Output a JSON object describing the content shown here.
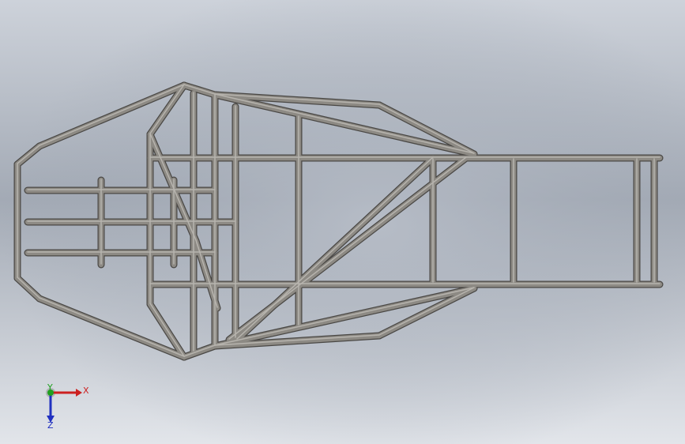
{
  "viewport": {
    "background_top": "#c9ced6",
    "background_mid": "#a4abb6",
    "background_bottom": "#dfe2e7",
    "model": "tube-frame-chassis",
    "view": "top"
  },
  "triad": {
    "x_label": "X",
    "y_label": "Y",
    "z_label": "Z",
    "x_color": "#cc2020",
    "y_color": "#20a020",
    "z_color": "#2030c0"
  },
  "tube_color": "#8d8a84"
}
